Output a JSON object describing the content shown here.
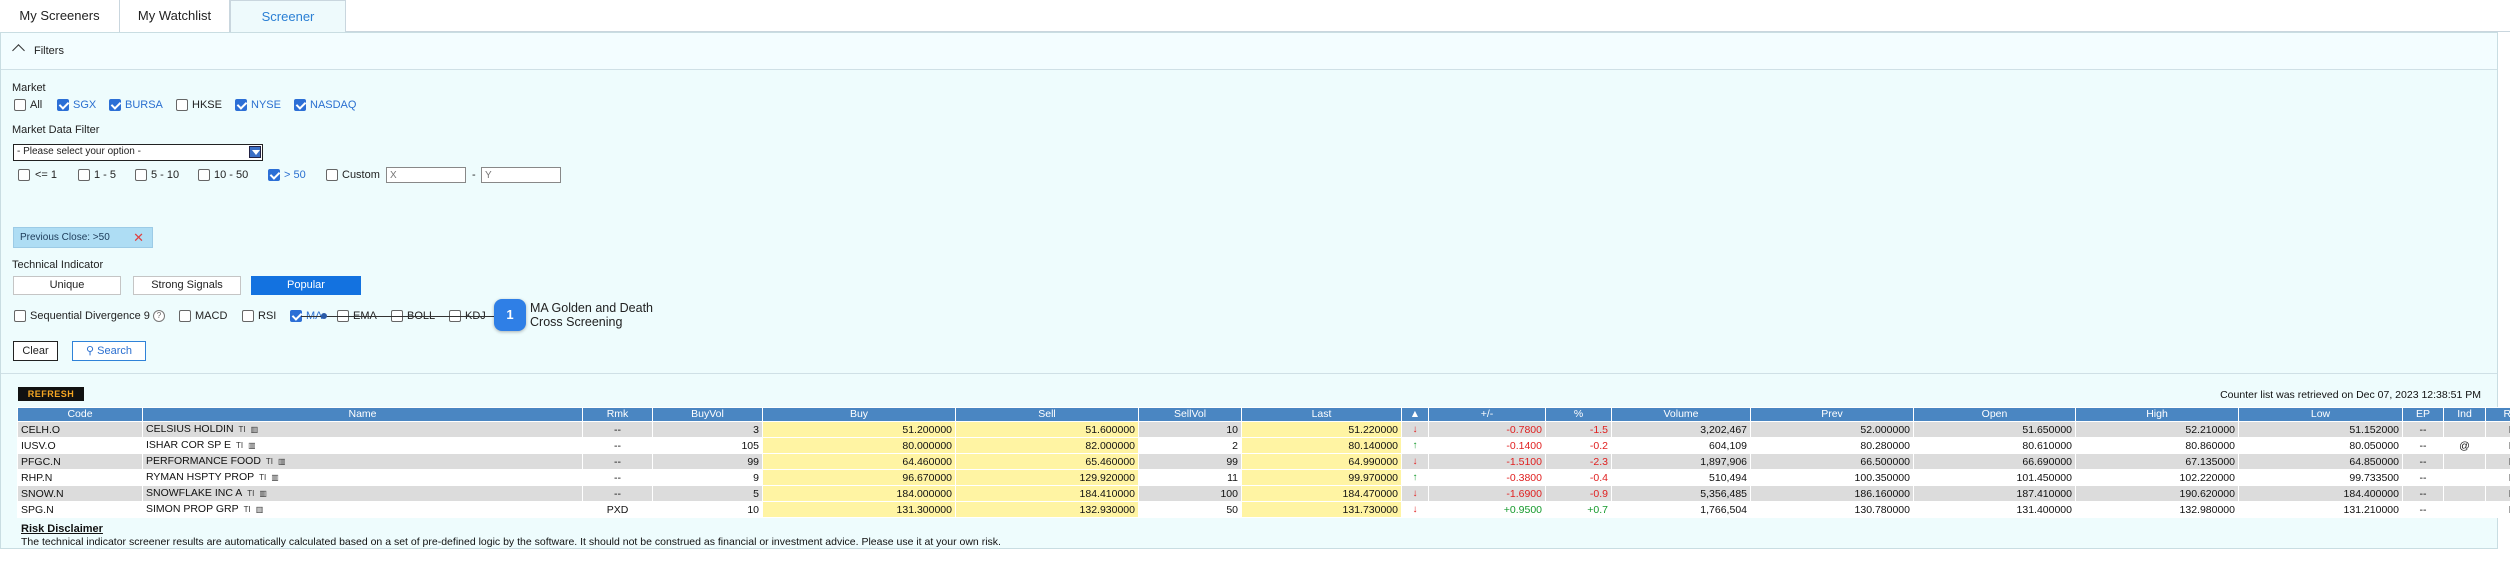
{
  "tabs": [
    {
      "label": "My Screeners"
    },
    {
      "label": "My Watchlist"
    },
    {
      "label": "Screener"
    }
  ],
  "filters": {
    "title": "Filters",
    "market": {
      "label": "Market",
      "options": [
        {
          "label": "All",
          "checked": false
        },
        {
          "label": "SGX",
          "checked": true
        },
        {
          "label": "BURSA",
          "checked": true
        },
        {
          "label": "HKSE",
          "checked": false
        },
        {
          "label": "NYSE",
          "checked": true
        },
        {
          "label": "NASDAQ",
          "checked": true
        }
      ]
    },
    "market_data_filter": {
      "label": "Market Data Filter",
      "select_value": "- Please select your option -",
      "ranges": [
        {
          "label": "<= 1",
          "checked": false
        },
        {
          "label": "1 - 5",
          "checked": false
        },
        {
          "label": "5 - 10",
          "checked": false
        },
        {
          "label": "10 - 50",
          "checked": false
        },
        {
          "label": "> 50",
          "checked": true
        },
        {
          "label": "Custom",
          "checked": false
        }
      ],
      "custom_x_placeholder": "X",
      "custom_dash": "-",
      "custom_y_placeholder": "Y"
    },
    "active_chip": "Previous Close: >50",
    "technical_indicator": {
      "label": "Technical Indicator",
      "segments": [
        {
          "label": "Unique",
          "active": false
        },
        {
          "label": "Strong Signals",
          "active": false
        },
        {
          "label": "Popular",
          "active": true
        }
      ],
      "indicators": [
        {
          "label": "Sequential Divergence 9",
          "checked": false
        },
        {
          "label": "MACD",
          "checked": false
        },
        {
          "label": "RSI",
          "checked": false
        },
        {
          "label": "MA",
          "checked": true
        },
        {
          "label": "EMA",
          "checked": false
        },
        {
          "label": "BOLL",
          "checked": false
        },
        {
          "label": "KDJ",
          "checked": false
        }
      ],
      "help_glyph": "?"
    },
    "tooltip": {
      "badge": "1",
      "text_line1": "MA Golden and Death",
      "text_line2": "Cross Screening"
    },
    "clear_label": "Clear",
    "search_label": "Search"
  },
  "results": {
    "refresh_label": "REFRESH",
    "retrieved_text": "Counter list was retrieved on Dec 07, 2023 12:38:51 PM",
    "columns": [
      "Code",
      "Name",
      "Rmk",
      "BuyVol",
      "Buy",
      "Sell",
      "SellVol",
      "Last",
      "▲",
      "+/-",
      "%",
      "Volume",
      "Prev",
      "Open",
      "High",
      "Low",
      "EP",
      "Ind",
      "R/D"
    ],
    "rows": [
      {
        "code": "CELH.O",
        "name": "CELSIUS HOLDIN",
        "rmk": "--",
        "buyvol": "3",
        "buy": "51.200000",
        "sell": "51.600000",
        "sellvol": "10",
        "last": "51.220000",
        "dir": "down",
        "chg": "-0.7800",
        "pct": "-1.5",
        "volume": "3,202,467",
        "prev": "52.000000",
        "open": "51.650000",
        "high": "52.210000",
        "low": "51.152000",
        "ep": "--",
        "ind": "",
        "rd": "R"
      },
      {
        "code": "IUSV.O",
        "name": "ISHAR COR SP E",
        "rmk": "--",
        "buyvol": "105",
        "buy": "80.000000",
        "sell": "82.000000",
        "sellvol": "2",
        "last": "80.140000",
        "dir": "up",
        "chg": "-0.1400",
        "pct": "-0.2",
        "volume": "604,109",
        "prev": "80.280000",
        "open": "80.610000",
        "high": "80.860000",
        "low": "80.050000",
        "ep": "--",
        "ind": "@",
        "rd": "R"
      },
      {
        "code": "PFGC.N",
        "name": "PERFORMANCE FOOD",
        "rmk": "--",
        "buyvol": "99",
        "buy": "64.460000",
        "sell": "65.460000",
        "sellvol": "99",
        "last": "64.990000",
        "dir": "down",
        "chg": "-1.5100",
        "pct": "-2.3",
        "volume": "1,897,906",
        "prev": "66.500000",
        "open": "66.690000",
        "high": "67.135000",
        "low": "64.850000",
        "ep": "--",
        "ind": "",
        "rd": "R"
      },
      {
        "code": "RHP.N",
        "name": "RYMAN HSPTY PROP",
        "rmk": "--",
        "buyvol": "9",
        "buy": "96.670000",
        "sell": "129.920000",
        "sellvol": "11",
        "last": "99.970000",
        "dir": "up",
        "chg": "-0.3800",
        "pct": "-0.4",
        "volume": "510,494",
        "prev": "100.350000",
        "open": "101.450000",
        "high": "102.220000",
        "low": "99.733500",
        "ep": "--",
        "ind": "",
        "rd": "R"
      },
      {
        "code": "SNOW.N",
        "name": "SNOWFLAKE INC A",
        "rmk": "--",
        "buyvol": "5",
        "buy": "184.000000",
        "sell": "184.410000",
        "sellvol": "100",
        "last": "184.470000",
        "dir": "down",
        "chg": "-1.6900",
        "pct": "-0.9",
        "volume": "5,356,485",
        "prev": "186.160000",
        "open": "187.410000",
        "high": "190.620000",
        "low": "184.400000",
        "ep": "--",
        "ind": "",
        "rd": "R"
      },
      {
        "code": "SPG.N",
        "name": "SIMON PROP GRP",
        "rmk": "PXD",
        "buyvol": "10",
        "buy": "131.300000",
        "sell": "132.930000",
        "sellvol": "50",
        "last": "131.730000",
        "dir": "down",
        "chg": "+0.9500",
        "pct": "+0.7",
        "volume": "1,766,504",
        "prev": "130.780000",
        "open": "131.400000",
        "high": "132.980000",
        "low": "131.210000",
        "ep": "--",
        "ind": "",
        "rd": "R"
      }
    ]
  },
  "disclaimer": {
    "title": "Risk Disclaimer",
    "text": "The technical indicator screener results are automatically calculated based on a set of pre-defined logic by the software. It should not be construed as financial or investment advice. Please use it at your own risk."
  },
  "colors": {
    "accent": "#1372e0",
    "header": "#4a86c2",
    "highlight": "#fff4a3",
    "down": "#e02020",
    "up": "#159a2c"
  }
}
